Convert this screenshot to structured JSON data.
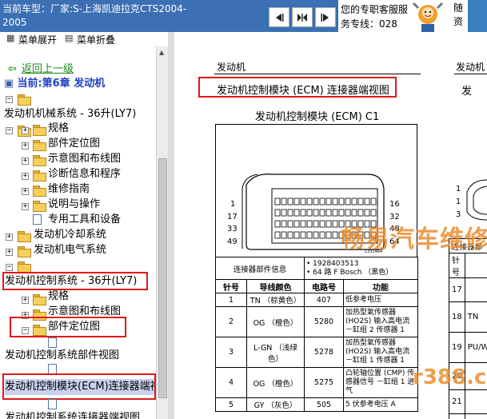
{
  "header": {
    "car_model": "当前车型：厂家:S-上海凯迪拉克CTS2004-2005",
    "service_text": "您的专职客服服务专线：028",
    "vertical_text": "随资"
  },
  "toolbar": {
    "expand_label": "菜单展开",
    "collapse_label": "菜单折叠"
  },
  "tree": {
    "back_label": "返回上一级",
    "current_label": "当前:第6章 发动机",
    "items": [
      "发动机机械系统 - 36升(LY7)",
      "规格",
      "部件定位图",
      "示意图和布线图",
      "诊断信息和程序",
      "维修指南",
      "说明与操作",
      "专用工具和设备",
      "发动机冷却系统",
      "发动机电气系统",
      "发动机控制系统 - 36升(LY7)",
      "规格",
      "示意图和布线图",
      "部件定位图",
      "发动机控制系统部件视图",
      "发动机控制模块(ECM)连接器端视图",
      "发动机控制系统连接器端视图"
    ]
  },
  "content": {
    "section_label": "发动机",
    "section_label_right": "发动机",
    "figure_title": "发动机控制模块 (ECM) 连接器端视图",
    "figure_title_right": "发",
    "diagram_title": "发动机控制模块 (ECM) C1",
    "pins_left": [
      "1",
      "17",
      "33",
      "49"
    ],
    "pins_right": [
      "16",
      "32",
      "48",
      "64"
    ],
    "diagram_code": "1331464",
    "info_label": "连接器部件信息",
    "info_values": [
      "1928403513",
      "64 路 F Bosch （黑色）"
    ],
    "table_headers": [
      "针号",
      "导线颜色",
      "电路号",
      "功能"
    ],
    "table_rows": [
      {
        "pin": "1",
        "color": "TN （棕黄色）",
        "circuit": "407",
        "function": "低参考电压"
      },
      {
        "pin": "2",
        "color": "OG （橙色）",
        "circuit": "5280",
        "function": "加热型氧传感器 (HO2S) 输入高电流 －缸组 2 传感器 1"
      },
      {
        "pin": "3",
        "color": "L-GN （浅绿色）",
        "circuit": "5278",
        "function": "加热型氧传感器 (HO2S) 输入高电流 －缸组 1 传感器 1"
      },
      {
        "pin": "4",
        "color": "OG （橙色）",
        "circuit": "5275",
        "function": "凸轮轴位置 (CMP) 传感器信号 －缸组 1 进气"
      },
      {
        "pin": "5",
        "color": "GY （灰色）",
        "circuit": "505",
        "function": "5 伏参考电压 A"
      }
    ],
    "right_table_header": "连接器部",
    "right_col_header": "针号",
    "right_rows": [
      {
        "pin": "17",
        "color": ""
      },
      {
        "pin": "18",
        "color": "TN"
      },
      {
        "pin": "19",
        "color": "PU/W"
      },
      {
        "pin": "20",
        "color": ""
      },
      {
        "pin": "21",
        "color": ""
      },
      {
        "pin": "22",
        "color": ""
      }
    ],
    "watermark_text": "畅易汽车维修",
    "watermark_text2": "r388.co"
  }
}
